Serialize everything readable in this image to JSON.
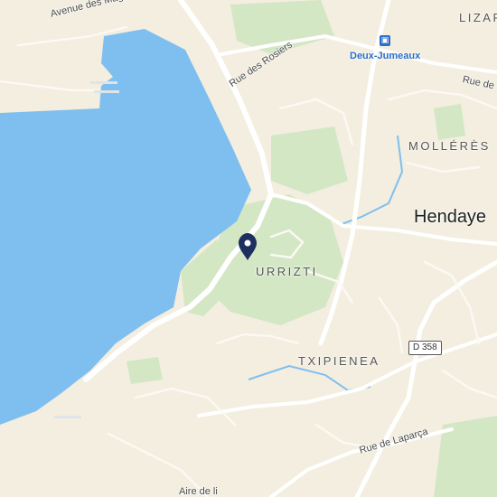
{
  "map": {
    "colors": {
      "land": "#f3eedf",
      "water": "#7fbff0",
      "park": "#d3e7c4",
      "road_major": "#ffffff",
      "road_minor": "#fbf9f3",
      "marker": "#1d2f5e",
      "station": "#2a6fc9"
    },
    "streets": {
      "avenue_des_magnolias": "Avenue des Magnolias",
      "rue_des_rosiers": "Rue des Rosiers",
      "rue_de_laparca": "Rue de Laparça",
      "rue_de_partial": "Rue de d",
      "bottom_partial": "Aire de li"
    },
    "districts": {
      "lizar": "LIZAR",
      "molleres": "MOLLÉRÈS",
      "urrizti": "URRIZTI",
      "txipienea": "TXIPIENEA"
    },
    "city": "Hendaye",
    "station": {
      "name": "Deux-Jumeaux",
      "icon": "train-station-icon"
    },
    "route_shield": "D 358",
    "marker": {
      "icon": "location-pin-icon"
    }
  }
}
